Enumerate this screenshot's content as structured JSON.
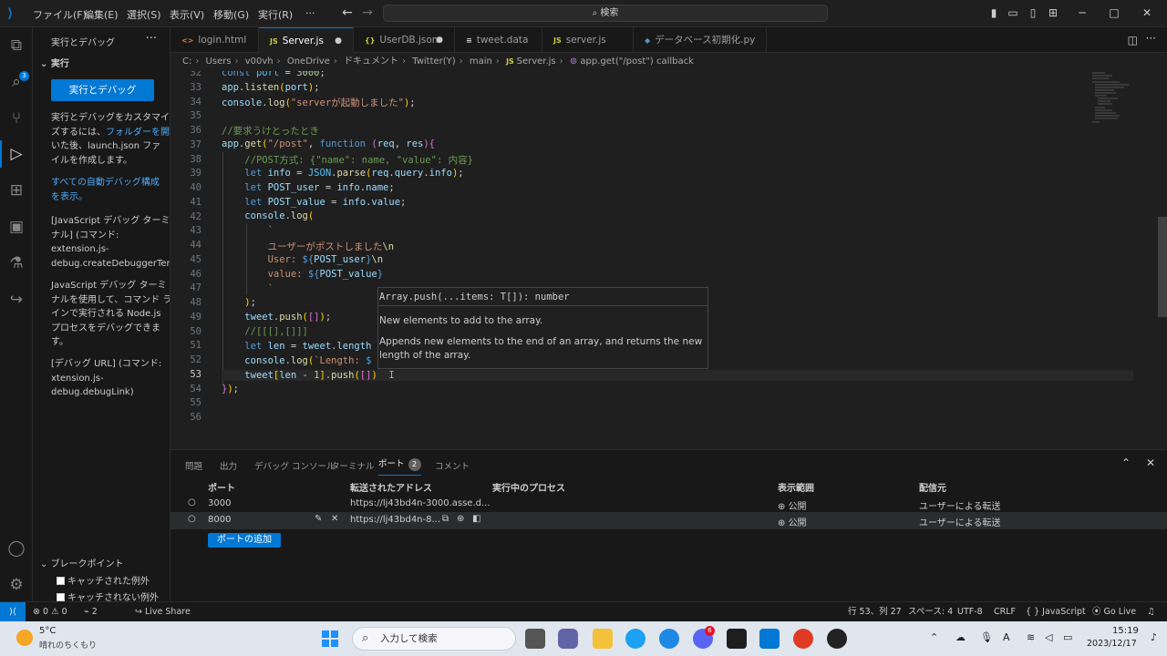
{
  "menu": [
    "ファイル(F)",
    "編集(E)",
    "選択(S)",
    "表示(V)",
    "移動(G)",
    "実行(R)",
    "···"
  ],
  "search": {
    "label": "検索"
  },
  "sidebar": {
    "title": "実行とデバッグ",
    "section": "実行",
    "run_button": "実行とデバッグ",
    "p1_lines": [
      "実行とデバッグをカスタマイ",
      "ズするには、",
      "いた後、launch.json ファ",
      "イルを作成します。"
    ],
    "p1_link": "フォルダーを開",
    "p2_lines": [
      "すべての自動デバッグ構成",
      "を表示。"
    ],
    "p3_lines": [
      "[JavaScript デバッグ ターミ",
      "ナル] (コマンド:",
      "extension.js-",
      "debug.createDebuggerTerm"
    ],
    "p4_lines": [
      "JavaScript デバッグ ターミ",
      "ナルを使用して、コマンド ラ",
      "インで実行される Node.js",
      "プロセスをデバッグできま",
      "す。"
    ],
    "p5_lines": [
      "[デバッグ URL] (コマンド:",
      "xtension.js-",
      "debug.debugLink)"
    ],
    "breakpoints": {
      "title": "ブレークポイント",
      "items": [
        "キャッチされた例外",
        "キャッチされない例外"
      ]
    }
  },
  "tabs": [
    {
      "label": "login.html",
      "icon": "<>",
      "state": "close"
    },
    {
      "label": "Server.js",
      "icon": "JS",
      "state": "dirty"
    },
    {
      "label": "UserDB.json",
      "icon": "{}",
      "state": "dirty"
    },
    {
      "label": "tweet.data",
      "icon": "≡",
      "state": ""
    },
    {
      "label": "server.js",
      "icon": "JS",
      "state": ""
    },
    {
      "label": "データベース初期化.py",
      "icon": "◆",
      "state": ""
    }
  ],
  "breadcrumb": [
    "C:",
    "Users",
    "v00vh",
    "OneDrive",
    "ドキュメント",
    "Twitter(Y)",
    "main",
    "Server.js",
    "app.get(\"/post\") callback"
  ],
  "line_numbers": [
    "32",
    "33",
    "34",
    "35",
    "36",
    "37",
    "38",
    "39",
    "40",
    "41",
    "42",
    "43",
    "44",
    "45",
    "46",
    "47",
    "48",
    "49",
    "50",
    "51",
    "52",
    "53",
    "54",
    "55",
    "56"
  ],
  "hover": {
    "signature": "Array.push(...items: T[]): number",
    "param_doc": "New elements to add to the array.",
    "description": "Appends new elements to the end of an array, and returns the new length of the array."
  },
  "panel": {
    "tabs": [
      "問題",
      "出力",
      "デバッグ コンソール",
      "ターミナル",
      "ポート",
      "コメント"
    ],
    "ports_badge": "2",
    "columns": [
      "ポート",
      "転送されたアドレス",
      "実行中のプロセス",
      "表示範囲",
      "配信元"
    ],
    "rows": [
      {
        "port": "3000",
        "address": "https://lj43bd4n-3000.asse.d...",
        "visibility": "公開",
        "origin": "ユーザーによる転送"
      },
      {
        "port": "8000",
        "address": "https://lj43bd4n-8...",
        "visibility": "公開",
        "origin": "ユーザーによる転送"
      }
    ],
    "add_port": "ポートの追加"
  },
  "status": {
    "errors": "0",
    "warnings": "0",
    "ports": "2",
    "live_share": "Live Share",
    "position": "行 53、列 27",
    "spaces": "スペース: 4",
    "encoding": "UTF-8",
    "eol": "CRLF",
    "language": "JavaScript",
    "golive": "Go Live"
  },
  "taskbar": {
    "weather_temp": "5°C",
    "weather_desc": "晴れのちくもり",
    "search_placeholder": "入力して検索",
    "time": "15:19",
    "date": "2023/12/17",
    "discord_badge": "6"
  }
}
